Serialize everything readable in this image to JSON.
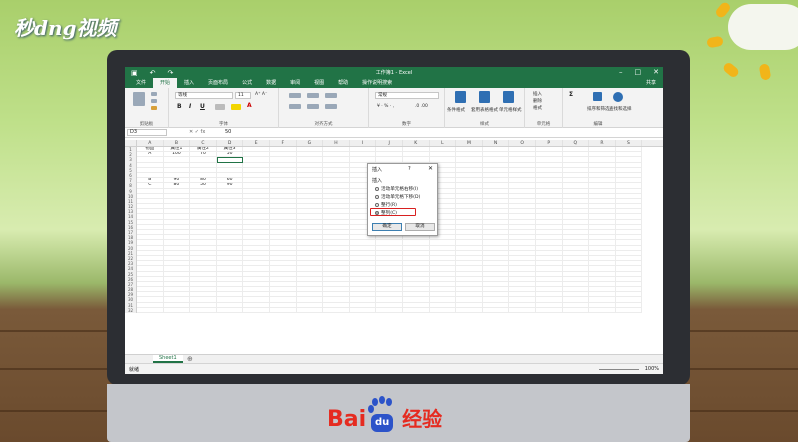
{
  "overlay": {
    "brand": "秒d",
    "brand_mid": "ng",
    "brand_end": "视频",
    "watermark_left": "Bai",
    "watermark_paw": "du",
    "watermark_right": "经验"
  },
  "excel": {
    "title": "工作簿1 - Excel",
    "menu": [
      "文件",
      "开始",
      "插入",
      "页面布局",
      "公式",
      "数据",
      "审阅",
      "视图",
      "帮助"
    ],
    "active_menu": "开始",
    "tellme": "操作说明搜索",
    "share": "共享",
    "ribbon": {
      "font_name": "等线",
      "font_size": "11",
      "number_format": "常规",
      "groups": [
        "剪贴板",
        "字体",
        "对齐方式",
        "数字",
        "样式",
        "单元格",
        "编辑"
      ],
      "style_labels": [
        "条件格式",
        "套用表格格式",
        "单元格样式"
      ],
      "cell_labels": [
        "插入",
        "删除",
        "格式"
      ],
      "edit_labels": [
        "排序和筛选",
        "查找和选择"
      ]
    },
    "namebox": "D3",
    "formula_value": "50",
    "columns": [
      "A",
      "B",
      "C",
      "D",
      "E",
      "F",
      "G",
      "H",
      "I",
      "J",
      "K",
      "L",
      "M",
      "N",
      "O",
      "P",
      "Q",
      "R",
      "S"
    ],
    "rows": [
      [
        "物品",
        "属性1",
        "属性2",
        "属性3"
      ],
      [
        "A",
        "100",
        "70",
        "50"
      ],
      [
        "",
        "",
        "",
        ""
      ],
      [
        "",
        "",
        "",
        ""
      ],
      [
        "",
        "",
        "",
        ""
      ],
      [
        "",
        "",
        "",
        ""
      ],
      [
        "B",
        "90",
        "80",
        "60"
      ],
      [
        "C",
        "80",
        "50",
        "90"
      ]
    ],
    "row_count": 32,
    "sheet_tab": "Sheet1",
    "status": "就绪",
    "zoom": "100%"
  },
  "dialog": {
    "title": "插入",
    "help": "?",
    "section": "插入",
    "options": [
      {
        "label": "活动单元格右移(I)",
        "selected": false
      },
      {
        "label": "活动单元格下移(D)",
        "selected": false
      },
      {
        "label": "整行(R)",
        "selected": false
      },
      {
        "label": "整列(C)",
        "selected": true
      }
    ],
    "ok": "确定",
    "cancel": "取消"
  }
}
